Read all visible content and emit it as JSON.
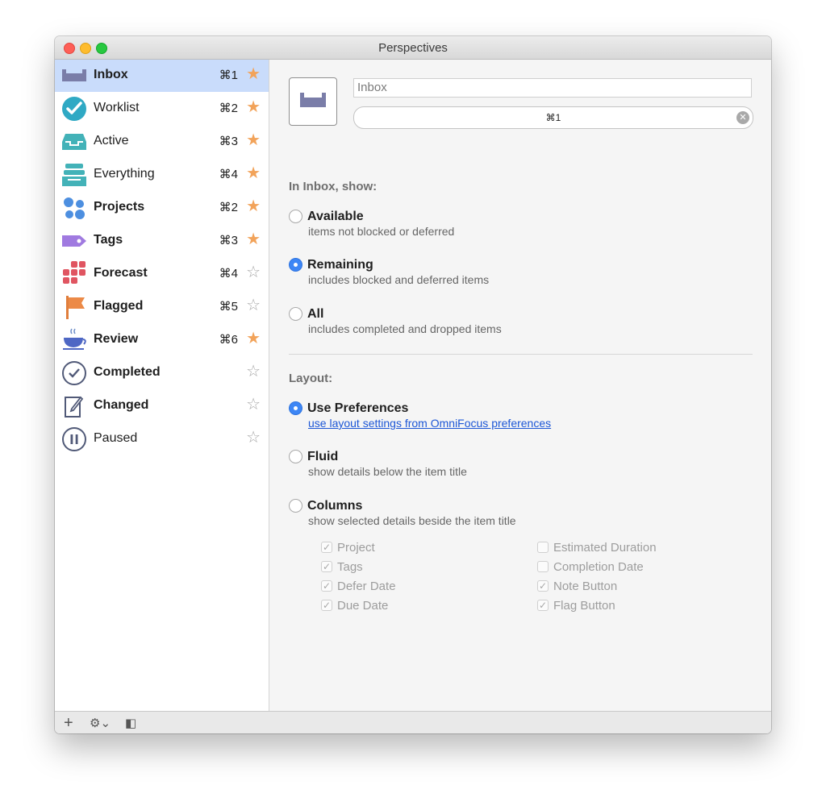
{
  "window": {
    "title": "Perspectives"
  },
  "sidebar": {
    "items": [
      {
        "label": "Inbox",
        "shortcut": "⌘1",
        "star": "★",
        "icon": "inbox-icon"
      },
      {
        "label": "Worklist",
        "shortcut": "⌘2",
        "star": "★",
        "icon": "worklist-check-icon"
      },
      {
        "label": "Active",
        "shortcut": "⌘3",
        "star": "★",
        "icon": "active-tray-icon"
      },
      {
        "label": "Everything",
        "shortcut": "⌘4",
        "star": "★",
        "icon": "everything-stack-icon"
      },
      {
        "label": "Projects",
        "shortcut": "⌘2",
        "star": "★",
        "icon": "projects-dots-icon"
      },
      {
        "label": "Tags",
        "shortcut": "⌘3",
        "star": "★",
        "icon": "tag-icon"
      },
      {
        "label": "Forecast",
        "shortcut": "⌘4",
        "star": "☆",
        "icon": "forecast-grid-icon"
      },
      {
        "label": "Flagged",
        "shortcut": "⌘5",
        "star": "☆",
        "icon": "flag-icon"
      },
      {
        "label": "Review",
        "shortcut": "⌘6",
        "star": "★",
        "icon": "review-cup-icon"
      },
      {
        "label": "Completed",
        "shortcut": "",
        "star": "☆",
        "icon": "completed-check-icon"
      },
      {
        "label": "Changed",
        "shortcut": "",
        "star": "☆",
        "icon": "changed-edit-icon"
      },
      {
        "label": "Paused",
        "shortcut": "",
        "star": "☆",
        "icon": "paused-icon"
      }
    ]
  },
  "bottombar": {
    "add": "+",
    "gear": "⚙⌄",
    "sidebar_toggle": "◧"
  },
  "detail": {
    "name_value": "Inbox",
    "shortcut_value": "⌘1",
    "clear_glyph": "✕",
    "show_label": "In Inbox, show:",
    "show_options": [
      {
        "title": "Available",
        "desc": "items not blocked or deferred"
      },
      {
        "title": "Remaining",
        "desc": "includes blocked and deferred items"
      },
      {
        "title": "All",
        "desc": "includes completed and dropped items"
      }
    ],
    "layout_label": "Layout:",
    "layout_options": [
      {
        "title": "Use Preferences",
        "desc": "use layout settings from OmniFocus preferences"
      },
      {
        "title": "Fluid",
        "desc": "show details below the item title"
      },
      {
        "title": "Columns",
        "desc": "show selected details beside the item title"
      }
    ],
    "columns_left": [
      {
        "label": "Project",
        "mark": "✓"
      },
      {
        "label": "Tags",
        "mark": "✓"
      },
      {
        "label": "Defer Date",
        "mark": "✓"
      },
      {
        "label": "Due Date",
        "mark": "✓"
      }
    ],
    "columns_right": [
      {
        "label": "Estimated Duration",
        "mark": ""
      },
      {
        "label": "Completion Date",
        "mark": ""
      },
      {
        "label": "Note Button",
        "mark": "✓"
      },
      {
        "label": "Flag Button",
        "mark": "✓"
      }
    ]
  }
}
